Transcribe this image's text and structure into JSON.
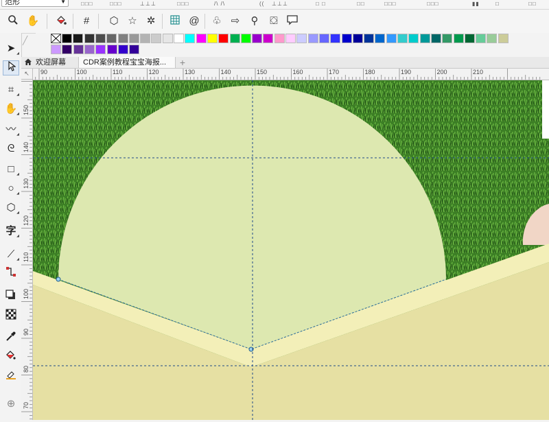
{
  "toolbar_top": {
    "style_combo_value": "范形"
  },
  "toolbar": {
    "icons": [
      "zoom-icon",
      "pan-icon",
      "interactive-fill-icon",
      "grid-icon",
      "polygon-icon",
      "star-icon",
      "complex-star-icon",
      "graph-paper-icon",
      "spiral-icon",
      "basic-shapes-icon",
      "arrow-shapes-icon",
      "flowchart-shapes-icon",
      "banner-shapes-icon",
      "callout-shapes-icon"
    ]
  },
  "toolbox": {
    "tools": [
      "pick-tool",
      "shape-tool",
      "crop-tool",
      "pan-tool",
      "freehand-tool",
      "smart-drawing-tool",
      "rectangle-tool",
      "ellipse-tool",
      "polygon-tool",
      "text-tool",
      "parallel-dimension-tool",
      "connector-tool",
      "drop-shadow-tool",
      "transparency-tool",
      "eyedropper-tool",
      "interactive-fill-tool",
      "smart-fill-tool",
      "add-tool"
    ],
    "text_tool_glyph": "字",
    "active_tool": "shape-tool"
  },
  "palette": {
    "row1": [
      "#000000",
      "#1a1a1a",
      "#333333",
      "#4d4d4d",
      "#666666",
      "#808080",
      "#999999",
      "#b3b3b3",
      "#cccccc",
      "#e6e6e6",
      "#ffffff",
      "#00ffff",
      "#ff00ff",
      "#ffff00",
      "#ff0000",
      "#00b050",
      "#00ff00",
      "#9900cc",
      "#cc00cc",
      "#ff99cc",
      "#ffccff",
      "#ccccff",
      "#9999ff",
      "#6666ff",
      "#3333ff",
      "#0000cc",
      "#000099",
      "#003399",
      "#0066cc",
      "#3399ff",
      "#33cccc",
      "#00cccc",
      "#009999",
      "#006666",
      "#339966",
      "#00994d",
      "#006633",
      "#66cc99",
      "#99cc99",
      "#cccc99"
    ],
    "row2": [
      "#cc99ff",
      "#330066",
      "#663399",
      "#9966cc",
      "#9933ff",
      "#6600cc",
      "#3300cc",
      "#330099"
    ]
  },
  "tabs": {
    "welcome": "欢迎屏幕",
    "document": "CDR案例教程宝宝海报..."
  },
  "rulers": {
    "h_labels": [
      "90",
      "100",
      "110",
      "120",
      "130",
      "140",
      "150",
      "160",
      "170",
      "180",
      "190",
      "200",
      "210"
    ],
    "v_labels": [
      "150",
      "140",
      "130",
      "120",
      "110",
      "100",
      "90",
      "80",
      "70"
    ]
  },
  "canvas_colors": {
    "grass_dark": "#2f6b1e",
    "grass_light": "#5da53a",
    "semicircle": "#dde8b0",
    "band": "#f3efb8",
    "base": "#e6e0a3",
    "guide": "#1f4a8a"
  }
}
